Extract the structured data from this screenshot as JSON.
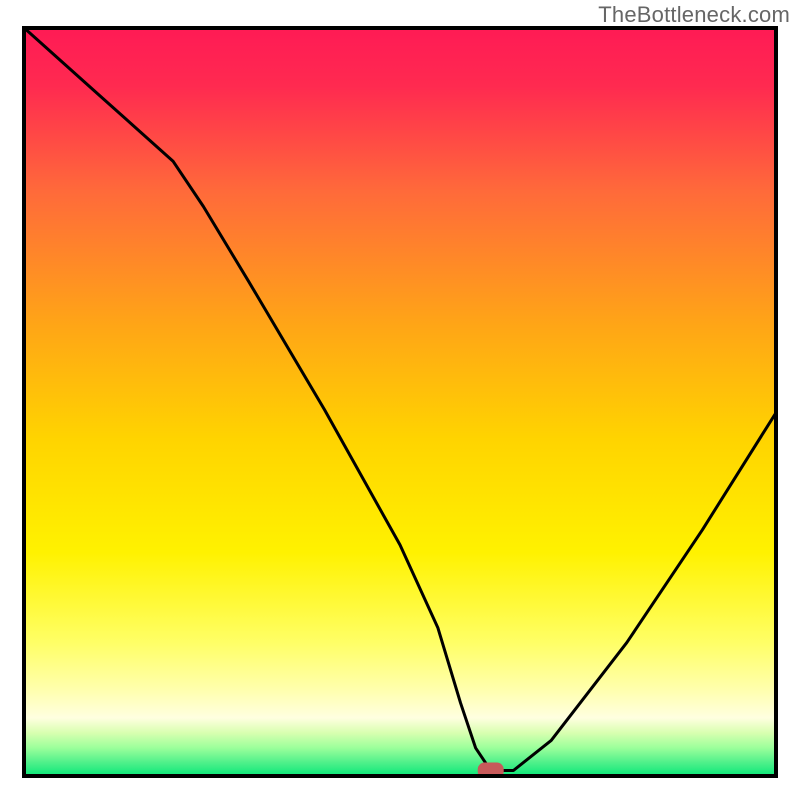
{
  "watermark": "TheBottleneck.com",
  "colors": {
    "line": "#000000",
    "marker": "#c75a5a",
    "gradient_top": "#ff1a55",
    "gradient_mid": "#ffd400",
    "gradient_yellow_light": "#ffff99",
    "gradient_green": "#00e676",
    "frame": "#000000"
  },
  "chart_data": {
    "type": "line",
    "title": "",
    "xlabel": "",
    "ylabel": "",
    "xlim": [
      0,
      100
    ],
    "ylim": [
      0,
      100
    ],
    "grid": false,
    "legend": false,
    "x": [
      0,
      10,
      20,
      24,
      30,
      40,
      50,
      55,
      58,
      60,
      62,
      65,
      70,
      80,
      90,
      100
    ],
    "values": [
      100,
      91,
      82,
      76,
      66,
      49,
      31,
      20,
      10,
      4,
      1,
      1,
      5,
      18,
      33,
      49
    ],
    "marker": {
      "x": 62,
      "y": 1
    }
  }
}
